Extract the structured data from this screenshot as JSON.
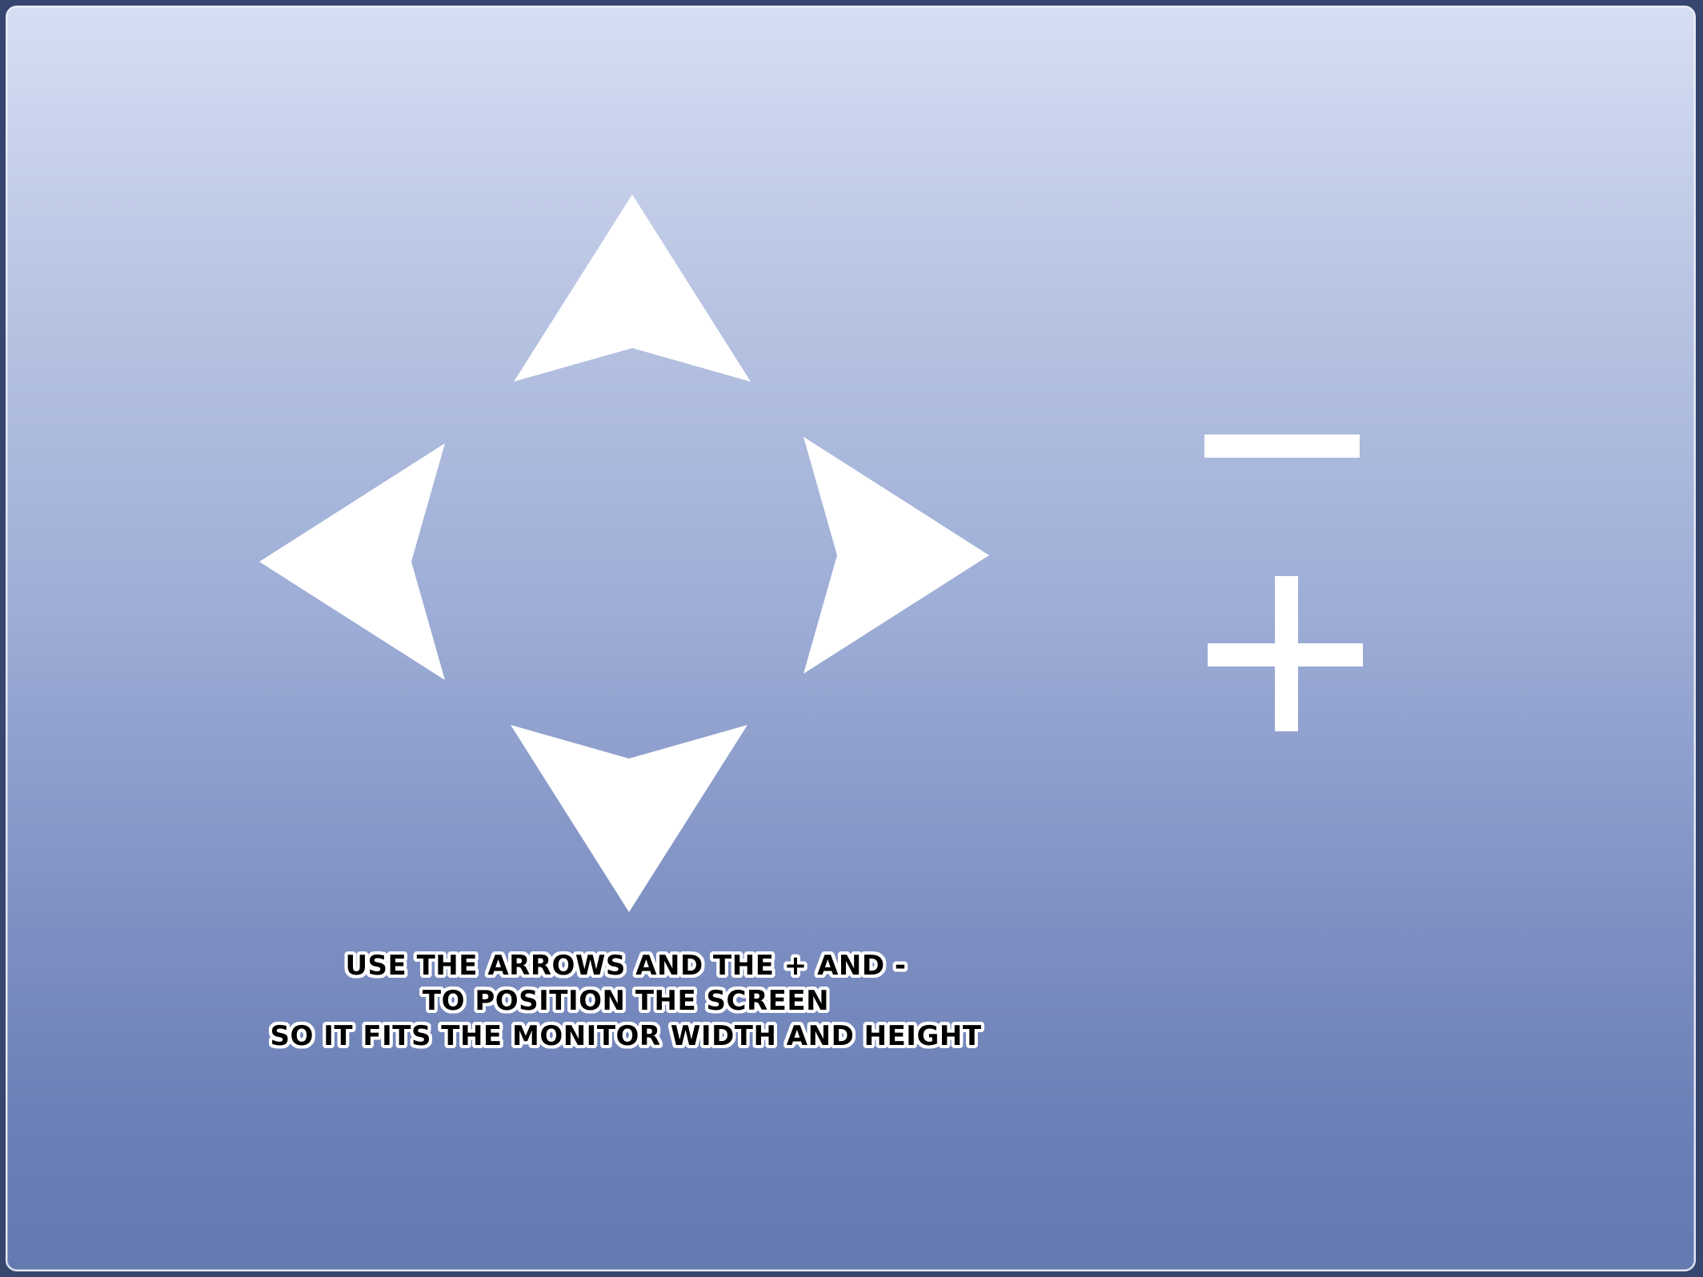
{
  "colors": {
    "background_top": "#d6def3",
    "background_bottom": "#6579b1",
    "controls": "#ffffff",
    "text": "#000000",
    "text_outline": "#ffffff"
  },
  "controls": {
    "up": {
      "icon": "up-arrow-icon"
    },
    "down": {
      "icon": "down-arrow-icon"
    },
    "left": {
      "icon": "left-arrow-icon"
    },
    "right": {
      "icon": "right-arrow-icon"
    },
    "zoom_out": {
      "icon": "minus-icon"
    },
    "zoom_in": {
      "icon": "plus-icon"
    }
  },
  "instructions": {
    "line1": "USE THE ARROWS AND THE + AND -",
    "line2": "TO POSITION THE SCREEN",
    "line3": "SO IT FITS THE MONITOR WIDTH AND HEIGHT"
  }
}
